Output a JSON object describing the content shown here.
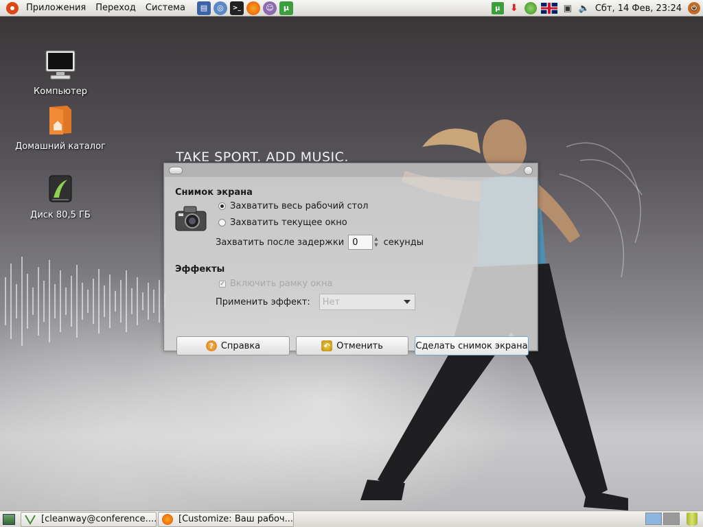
{
  "top_panel": {
    "menus": [
      "Приложения",
      "Переход",
      "Система"
    ],
    "launchers": [
      "file-manager-icon",
      "browser-icon",
      "terminal-icon",
      "firefox-icon",
      "messenger-icon",
      "torrent-icon"
    ],
    "clock": "Сбт, 14 Фев, 23:24"
  },
  "wallpaper": {
    "slogan": "TAKE SPORT. ADD MUSIC."
  },
  "desktop_icons": [
    {
      "label": "Компьютер",
      "icon": "computer-icon"
    },
    {
      "label": "Домашний каталог",
      "icon": "home-folder-icon"
    },
    {
      "label": "Диск 80,5 ГБ",
      "icon": "disk-icon"
    }
  ],
  "dialog": {
    "section_screenshot": "Снимок экрана",
    "option_desktop": "Захватить весь рабочий стол",
    "option_window": "Захватить текущее окно",
    "delay_label": "Захватить после задержки",
    "delay_value": "0",
    "delay_unit": "секунды",
    "section_effects": "Эффекты",
    "include_border": "Включить рамку окна",
    "effect_label": "Применить эффект:",
    "effect_value": "Нет",
    "help_button": "Справка",
    "cancel_button": "Отменить",
    "take_button": "Сделать снимок экрана"
  },
  "bottom_panel": {
    "tasks": [
      "[cleanway@conference....",
      "[Customize: Ваш рабоч..."
    ]
  },
  "colors": {
    "accent": "#dd4814",
    "default_button_border": "#7aa3d4"
  }
}
